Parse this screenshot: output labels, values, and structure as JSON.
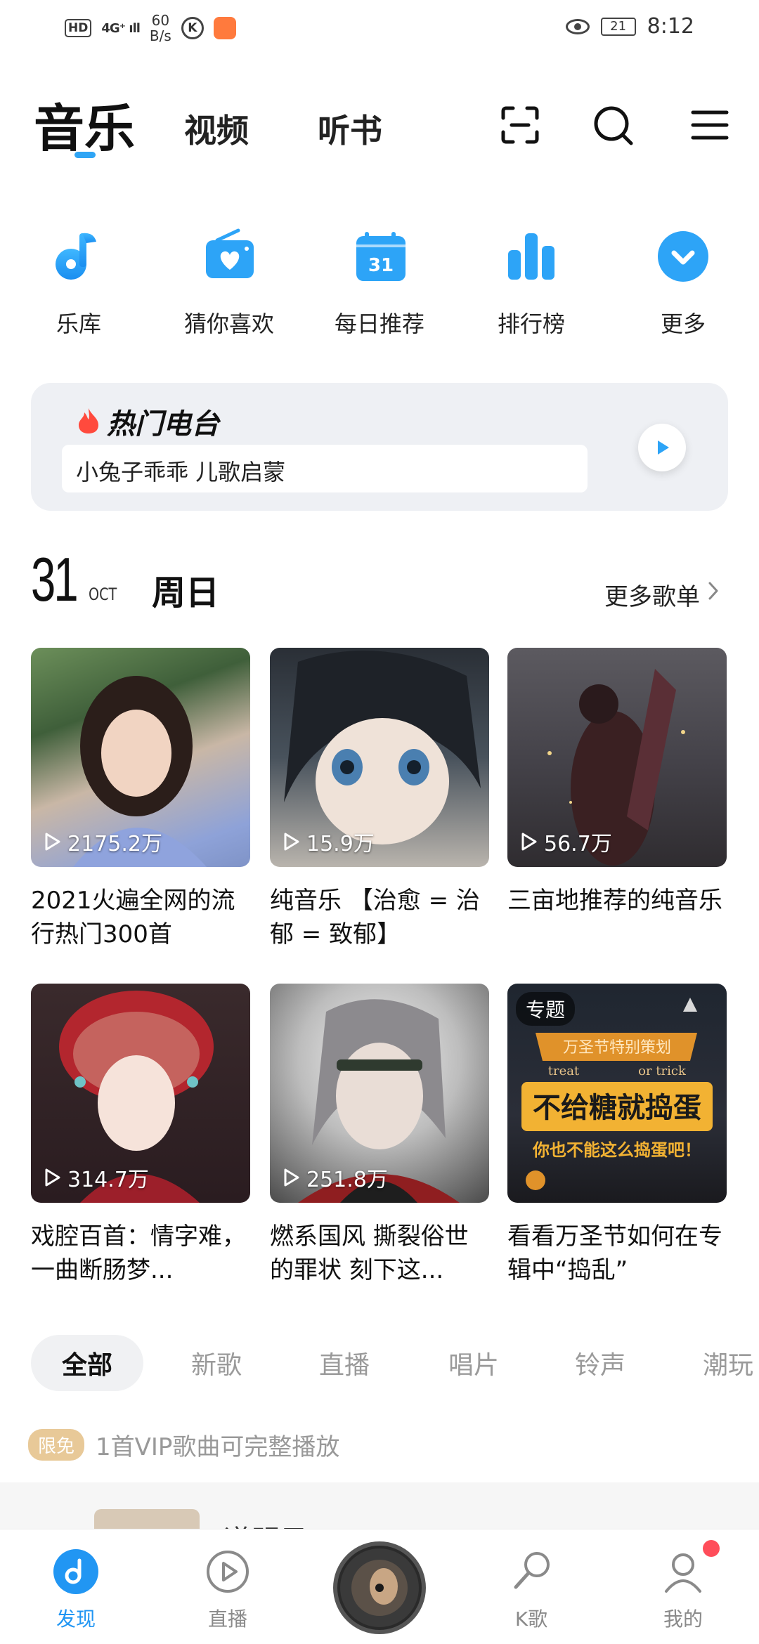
{
  "status_bar": {
    "hd": "HD",
    "signal": "4G⁺ ıll",
    "speed_value": "60",
    "speed_unit": "B/s",
    "k_icon": "K",
    "battery": "21",
    "time": "8:12"
  },
  "top_nav": {
    "tabs": [
      {
        "label": "音乐",
        "active": true
      },
      {
        "label": "视频"
      },
      {
        "label": "听书"
      }
    ],
    "accent": "#2fa5f5"
  },
  "quick_links": [
    {
      "label": "乐库",
      "icon": "music-note-icon"
    },
    {
      "label": "猜你喜欢",
      "icon": "radio-heart-icon"
    },
    {
      "label": "每日推荐",
      "icon": "calendar-icon",
      "icon_text": "31"
    },
    {
      "label": "排行榜",
      "icon": "bar-chart-icon"
    },
    {
      "label": "更多",
      "icon": "chevron-down-icon"
    }
  ],
  "hot_radio": {
    "title": "热门电台",
    "now_playing": "小兔子乖乖  儿歌启蒙"
  },
  "date": {
    "day": "31",
    "month": "OCT",
    "weekday": "周日",
    "more": "更多歌单"
  },
  "playlists": [
    {
      "plays": "2175.2万",
      "title": "2021火遍全网的流行热门300首"
    },
    {
      "plays": "15.9万",
      "title": "纯音乐  【治愈 = 治郁 = 致郁】"
    },
    {
      "plays": "56.7万",
      "title": "三亩地推荐的纯音乐"
    },
    {
      "plays": "314.7万",
      "title": "戏腔百首：情字难，一曲断肠梦..."
    },
    {
      "plays": "251.8万",
      "title": "燃系国风 撕裂俗世的罪状 刻下这..."
    },
    {
      "plays": "",
      "title": "看看万圣节如何在专辑中“捣乱”",
      "badge": "专题",
      "cover_text_1": "万圣节特别策划",
      "cover_text_2": "treat",
      "cover_text_3": "or trick",
      "cover_text_4": "不给糖就捣蛋",
      "cover_text_5": "你也不能这么捣蛋吧！"
    }
  ],
  "categories": [
    {
      "label": "全部",
      "active": true
    },
    {
      "label": "新歌"
    },
    {
      "label": "直播"
    },
    {
      "label": "唱片"
    },
    {
      "label": "铃声"
    },
    {
      "label": "潮玩"
    }
  ],
  "vip_strip": {
    "tag": "限免",
    "text": "1首VIP歌曲可完整播放"
  },
  "peek_text": "道明目",
  "bottom_nav": [
    {
      "label": "发现",
      "active": true
    },
    {
      "label": "直播"
    },
    {
      "label": ""
    },
    {
      "label": "K歌"
    },
    {
      "label": "我的"
    }
  ]
}
